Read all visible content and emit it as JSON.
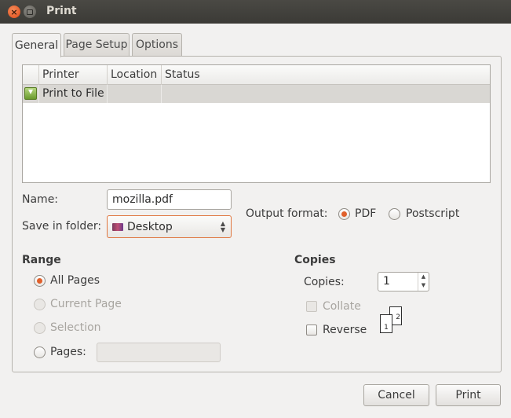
{
  "window": {
    "title": "Print",
    "close_symbol": "×"
  },
  "tabs": [
    {
      "label": "General",
      "active": true
    },
    {
      "label": "Page Setup",
      "active": false
    },
    {
      "label": "Options",
      "active": false
    }
  ],
  "printer_list": {
    "columns": {
      "printer": "Printer",
      "location": "Location",
      "status": "Status"
    },
    "rows": [
      {
        "icon": "print-to-file-icon",
        "printer": "Print to File",
        "location": "",
        "status": "",
        "selected": true
      }
    ]
  },
  "form": {
    "name_label": "Name:",
    "name_value": "mozilla.pdf",
    "folder_label": "Save in folder:",
    "folder_value": "Desktop",
    "output_label": "Output format:",
    "output_options": [
      {
        "label": "PDF",
        "selected": true
      },
      {
        "label": "Postscript",
        "selected": false
      }
    ]
  },
  "range": {
    "title": "Range",
    "options": [
      {
        "label": "All Pages",
        "selected": true,
        "enabled": true
      },
      {
        "label": "Current Page",
        "selected": false,
        "enabled": false
      },
      {
        "label": "Selection",
        "selected": false,
        "enabled": false
      },
      {
        "label": "Pages:",
        "selected": false,
        "enabled": true
      }
    ],
    "pages_value": ""
  },
  "copies": {
    "title": "Copies",
    "copies_label": "Copies:",
    "copies_value": "1",
    "collate_label": "Collate",
    "collate_checked": false,
    "collate_enabled": false,
    "reverse_label": "Reverse",
    "reverse_checked": false,
    "page_numbers": {
      "front": "1",
      "back": "2"
    }
  },
  "buttons": {
    "cancel": "Cancel",
    "print": "Print"
  },
  "colors": {
    "accent": "#e0602b",
    "titlebar": "#3b3a36",
    "selection": "#d9d7d3"
  }
}
